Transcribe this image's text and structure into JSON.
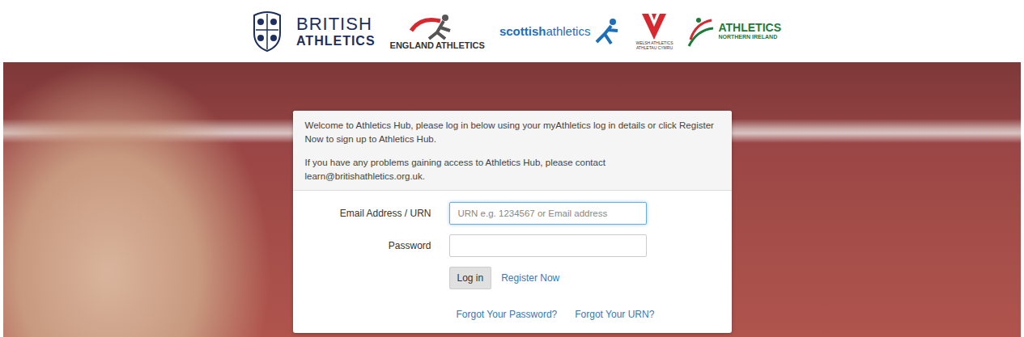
{
  "header": {
    "logos": [
      {
        "kind": "british",
        "lines": [
          "BRITISH",
          "ATHLETICS"
        ]
      },
      {
        "kind": "england",
        "lines": [
          "ENGLAND",
          "ATHLETICS"
        ]
      },
      {
        "kind": "scottish",
        "lines": [
          "scottish",
          "athletics"
        ]
      },
      {
        "kind": "welsh",
        "lines": [
          "WELSH ATHLETICS",
          "ATHLETAU CYMRU"
        ]
      },
      {
        "kind": "ni",
        "lines": [
          "ATHLETICS",
          "NORTHERN IRELAND"
        ]
      }
    ]
  },
  "login": {
    "intro": "Welcome to Athletics Hub, please log in below using your myAthletics log in details or click Register Now to sign up to Athletics Hub.",
    "help": "If you have any problems gaining access to Athletics Hub, please contact learn@britishathletics.org.uk.",
    "fields": [
      {
        "label": "Email Address / URN",
        "kind": "text",
        "placeholder": "URN e.g. 1234567 or Email address",
        "value": "",
        "focused": true
      },
      {
        "label": "Password",
        "kind": "password",
        "placeholder": "",
        "value": "",
        "focused": false
      }
    ],
    "login_button": "Log in",
    "register_link": "Register Now",
    "links": [
      "Forgot Your Password?",
      "Forgot Your URN?"
    ]
  }
}
